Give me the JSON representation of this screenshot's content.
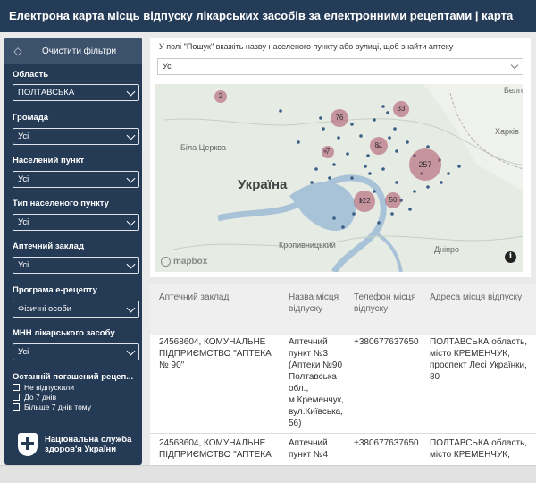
{
  "header": {
    "title": "Електрона карта місць відпуску лікарських засобів за електронними рецептами | карта"
  },
  "sidebar": {
    "clear_label": "Очистити фільтри",
    "filters": [
      {
        "label": "Область",
        "value": "ПОЛТАВСЬКА"
      },
      {
        "label": "Громада",
        "value": "Усі"
      },
      {
        "label": "Населений пункт",
        "value": "Усі"
      },
      {
        "label": "Тип населеного пункту",
        "value": "Усі"
      },
      {
        "label": "Аптечний заклад",
        "value": "Усі"
      },
      {
        "label": "Програма е-рецепту",
        "value": "Фізичні особи"
      },
      {
        "label": "МНН лікарського засобу",
        "value": "Усі"
      }
    ],
    "last_redeemed": {
      "label": "Останній погашений рецеп...",
      "options": [
        "Не відпускали",
        "До 7 днів",
        "Більше 7 днів тому"
      ]
    },
    "logo_text": [
      "Національна служба",
      "здоров'я України"
    ]
  },
  "map_panel": {
    "hint": "У полі \"Пошук\" вкажіть назву населеного пункту або вулиці, щоб знайти аптеку",
    "search_value": "Усі",
    "attribution": "mapbox",
    "info_icon": "info-icon",
    "labels": {
      "bila_tserkva": "Біла Церква",
      "ukraine": "Україна",
      "kharkiv": "Харків",
      "kropyvnytskyi": "Кропивницький",
      "dnipro": "Дніпро",
      "bilh": "Белго"
    },
    "clusters": [
      {
        "id": "c2",
        "count": "2"
      },
      {
        "id": "c76",
        "count": "76"
      },
      {
        "id": "c33",
        "count": "33"
      },
      {
        "id": "c81",
        "count": "81"
      },
      {
        "id": "c7",
        "count": "7"
      },
      {
        "id": "c257",
        "count": "257"
      },
      {
        "id": "c122",
        "count": "122"
      },
      {
        "id": "c50",
        "count": "50"
      }
    ]
  },
  "table": {
    "headers": [
      "Аптечний заклад",
      "Назва місця відпуску",
      "Телефон місця відпуску",
      "Адреса місця відпуску"
    ],
    "rows": [
      {
        "pharmacy": "24568604, КОМУНАЛЬНЕ ПІДПРИЄМСТВО \"АПТЕКА № 90\"",
        "place": "Аптечний пункт №3 (Аптеки №90 Полтавська обл., м.Кременчук, вул.Київська, 56)",
        "phone": "+380677637650",
        "address": "ПОЛТАВСЬКА область, місто КРЕМЕНЧУК, проспект Лесі Українки, 80"
      },
      {
        "pharmacy": "24568604, КОМУНАЛЬНЕ ПІДПРИЄМСТВО \"АПТЕКА",
        "place": "Аптечний пункт №4",
        "phone": "+380677637650",
        "address": "ПОЛТАВСЬКА область, місто КРЕМЕНЧУК,"
      }
    ]
  },
  "colors": {
    "header_bg": "#253c58",
    "sidebar_bg": "#243a55",
    "cluster": "#b05a6e",
    "dot": "#3a5f86"
  }
}
